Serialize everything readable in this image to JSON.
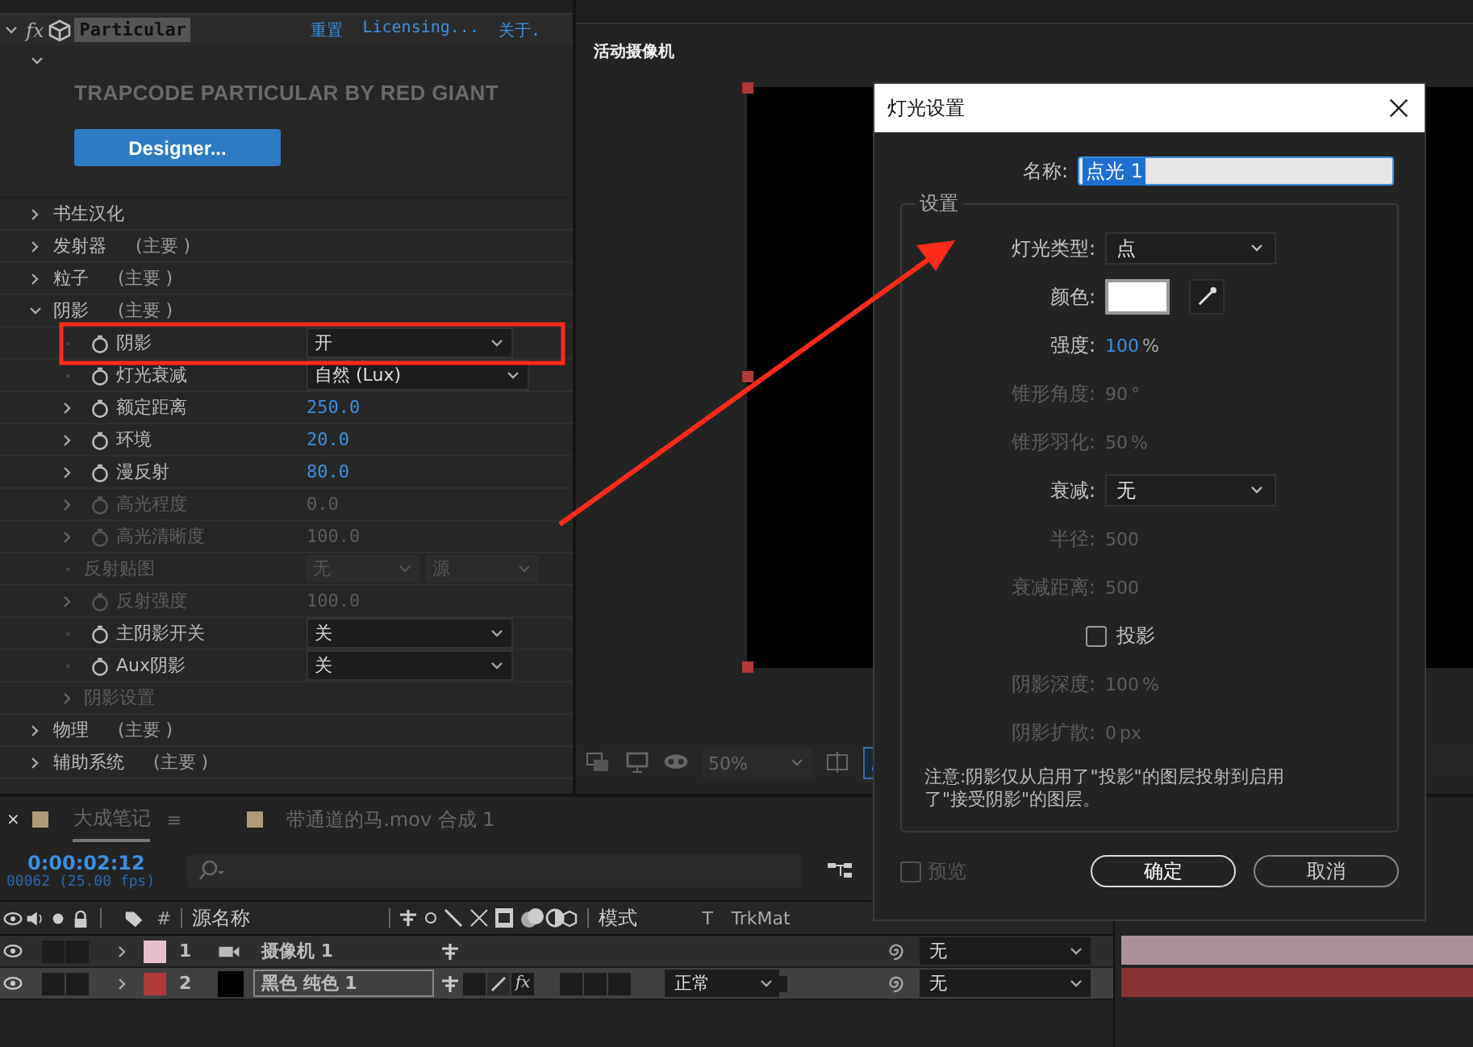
{
  "effect_panel": {
    "effect": {
      "fx_label": "fx",
      "name": "Particular",
      "links": [
        "重置",
        "Licensing...",
        "关于."
      ],
      "expanded": true
    },
    "banner": "TRAPCODE PARTICULAR BY RED GIANT",
    "designer_button": "Designer...",
    "params": [
      {
        "kind": "group",
        "label": "书生汉化",
        "expanded": false,
        "disabled": false
      },
      {
        "kind": "group",
        "label": "发射器",
        "tag": "(主要 )",
        "expanded": false,
        "disabled": false
      },
      {
        "kind": "group",
        "label": "粒子",
        "tag": "(主要 )",
        "expanded": false,
        "disabled": false
      },
      {
        "kind": "group",
        "label": "阴影",
        "tag": "(主要 )",
        "expanded": true,
        "disabled": false,
        "children": [
          {
            "kind": "dropdown",
            "label": "阴影",
            "value": "开",
            "disabled": false
          },
          {
            "kind": "dropdown",
            "label": "灯光衰减",
            "value": "自然 (Lux)",
            "disabled": false
          },
          {
            "kind": "number",
            "label": "额定距离",
            "value": "250.0",
            "expanded": false,
            "disabled": false
          },
          {
            "kind": "number",
            "label": "环境",
            "value": "20.0",
            "expanded": false,
            "disabled": false
          },
          {
            "kind": "number",
            "label": "漫反射",
            "value": "80.0",
            "expanded": false,
            "disabled": false
          },
          {
            "kind": "number",
            "label": "高光程度",
            "value": "0.0",
            "expanded": false,
            "disabled": true
          },
          {
            "kind": "number",
            "label": "高光清晰度",
            "value": "100.0",
            "expanded": false,
            "disabled": true
          },
          {
            "kind": "dual-dropdown",
            "label": "反射贴图",
            "value": "无",
            "value_2": "源",
            "disabled": true
          },
          {
            "kind": "number",
            "label": "反射强度",
            "value": "100.0",
            "expanded": false,
            "disabled": true
          },
          {
            "kind": "dropdown",
            "label": "主阴影开关",
            "value": "关",
            "disabled": false
          },
          {
            "kind": "dropdown",
            "label": "Aux阴影",
            "value": "关",
            "disabled": false
          },
          {
            "kind": "group",
            "label": "阴影设置",
            "expanded": false,
            "disabled": true
          }
        ]
      },
      {
        "kind": "group",
        "label": "物理",
        "tag": "(主要 )",
        "expanded": false,
        "disabled": false
      },
      {
        "kind": "group",
        "label": "辅助系统",
        "tag": "(主要 )",
        "expanded": false,
        "disabled": false
      }
    ]
  },
  "viewer": {
    "camera_label": "活动摄像机",
    "zoom": "50%"
  },
  "timeline": {
    "close": "×",
    "menu": "≡",
    "effect_switch_label": "fx",
    "tabs": [
      {
        "label": "大成笔记",
        "selected": true,
        "color": "#b09a78"
      },
      {
        "label": "带通道的马.mov 合成 1",
        "selected": false,
        "color": "#b09a78"
      }
    ],
    "timecode": "0:00:02:12",
    "frame_info": "00062 (25.00 fps)",
    "columns": {
      "number": "#",
      "source_name": "源名称",
      "mode": "模式",
      "t": "T",
      "trkmat": "TrkMat"
    },
    "layers": [
      {
        "number": "1",
        "name": "摄像机 1",
        "kind": "camera",
        "color": "#e8c0cc",
        "selected": false,
        "trkmat": "无"
      },
      {
        "number": "2",
        "name": "黑色 纯色 1",
        "kind": "solid",
        "color": "#b03a3a",
        "mode": "正常",
        "selected": true,
        "trkmat": "无"
      }
    ]
  },
  "dialog": {
    "title": "灯光设置",
    "name_label": "名称:",
    "name_value": "点光 1",
    "group_label": "设置",
    "rows": [
      {
        "kind": "dropdown",
        "label": "灯光类型:",
        "value": "点",
        "disabled": false
      },
      {
        "kind": "color",
        "label": "颜色:",
        "color": "#ffffff",
        "disabled": false
      },
      {
        "kind": "value",
        "label": "强度:",
        "value": "100",
        "unit": "%",
        "disabled": false
      },
      {
        "kind": "value",
        "label": "锥形角度:",
        "value": "90",
        "unit": "°",
        "disabled": true
      },
      {
        "kind": "value",
        "label": "锥形羽化:",
        "value": "50",
        "unit": "%",
        "disabled": true
      },
      {
        "kind": "dropdown",
        "label": "衰减:",
        "value": "无",
        "disabled": false
      },
      {
        "kind": "value",
        "label": "半径:",
        "value": "500",
        "disabled": true
      },
      {
        "kind": "value",
        "label": "衰减距离:",
        "value": "500",
        "disabled": true
      },
      {
        "kind": "checkbox",
        "label": "投影",
        "checked": false,
        "disabled": false
      },
      {
        "kind": "value",
        "label": "阴影深度:",
        "value": "100",
        "unit": "%",
        "disabled": true
      },
      {
        "kind": "value",
        "label": "阴影扩散:",
        "value": "0",
        "unit": "px",
        "disabled": true
      }
    ],
    "note": "注意:阴影仅从启用了\"投影\"的图层投射到启用了\"接受阴影\"的图层。",
    "preview": {
      "label": "预览",
      "checked": false
    },
    "buttons": [
      {
        "label": "确定",
        "default": true
      },
      {
        "label": "取消",
        "default": false
      }
    ]
  }
}
